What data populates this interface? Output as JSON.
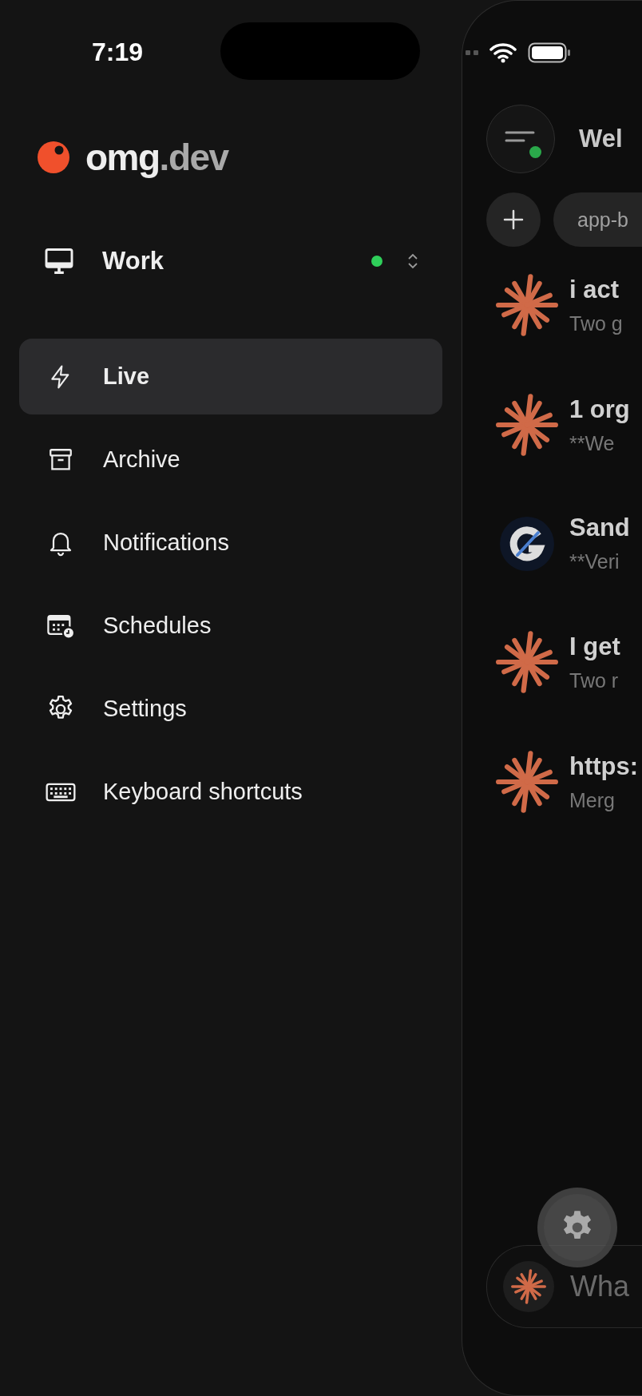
{
  "status_bar": {
    "time": "7:19"
  },
  "brand": {
    "name": "omg",
    "suffix": ".dev"
  },
  "workspace": {
    "label": "Work",
    "online": true
  },
  "sidebar": {
    "items": [
      {
        "label": "Live",
        "kind": "bolt",
        "selected": true
      },
      {
        "label": "Archive",
        "kind": "archive",
        "selected": false
      },
      {
        "label": "Notifications",
        "kind": "bell",
        "selected": false
      },
      {
        "label": "Schedules",
        "kind": "calendar",
        "selected": false
      },
      {
        "label": "Settings",
        "kind": "gear",
        "selected": false
      },
      {
        "label": "Keyboard shortcuts",
        "kind": "keyboard",
        "selected": false
      }
    ]
  },
  "main": {
    "menu_online": true,
    "title": "Wel",
    "chip": "app-b",
    "sessions": [
      {
        "kind": "asterisk",
        "title": "i act",
        "subtitle": "Two g"
      },
      {
        "kind": "asterisk",
        "title": "1 org",
        "subtitle": "**We"
      },
      {
        "kind": "logo",
        "title": "Sand",
        "subtitle": "**Veri"
      },
      {
        "kind": "asterisk",
        "title": "I get",
        "subtitle": "Two r"
      },
      {
        "kind": "asterisk",
        "title": "https:",
        "subtitle": "Merg"
      }
    ],
    "composer": {
      "placeholder": "Wha"
    }
  }
}
